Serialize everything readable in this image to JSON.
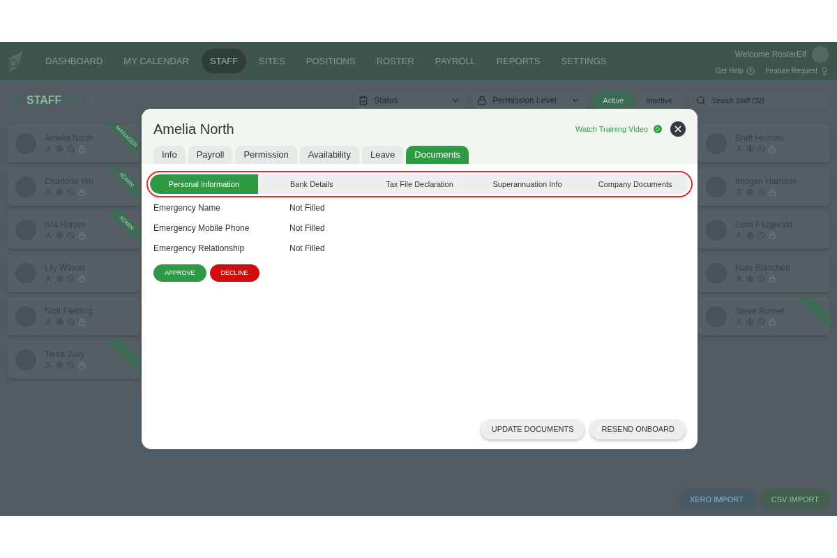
{
  "nav": {
    "items": [
      {
        "label": "DASHBOARD",
        "selected": false
      },
      {
        "label": "MY CALENDAR",
        "selected": false
      },
      {
        "label": "STAFF",
        "selected": true
      },
      {
        "label": "SITES",
        "selected": false
      },
      {
        "label": "POSITIONS",
        "selected": false
      },
      {
        "label": "ROSTER",
        "selected": false
      },
      {
        "label": "PAYROLL",
        "selected": false
      },
      {
        "label": "REPORTS",
        "selected": false
      },
      {
        "label": "SETTINGS",
        "selected": false
      }
    ],
    "welcome": "Welcome RosterElf",
    "get_help": "Get Help",
    "feature_request": "Feature Request"
  },
  "toolbar": {
    "title": "STAFF",
    "status": "Status",
    "permission": "Permission Level",
    "toggle": [
      {
        "label": "Active",
        "selected": true
      },
      {
        "label": "Inactive",
        "selected": false
      }
    ],
    "search_placeholder": "Search Staff (32)"
  },
  "staff_left": [
    {
      "name": "Amelia North",
      "role": "MANAGER"
    },
    {
      "name": "Charlotte Wu",
      "role": "ADMIN"
    },
    {
      "name": "Isla Harper",
      "role": "ADMIN"
    },
    {
      "name": "Lily Wilson"
    },
    {
      "name": "Nick Fielding"
    },
    {
      "name": "Tania Juvy",
      "ribbon": true
    }
  ],
  "staff_right": [
    {
      "name": "Brett Holmes"
    },
    {
      "name": "Imogen Harrison"
    },
    {
      "name": "Liam Fitzgerald"
    },
    {
      "name": "Nate Blanchett"
    },
    {
      "name": "Steve Russel",
      "ribbon": true
    }
  ],
  "import_buttons": [
    {
      "label": "XERO IMPORT",
      "kind": "xero"
    },
    {
      "label": "CSV IMPORT",
      "kind": "csv"
    }
  ],
  "modal": {
    "title": "Amelia North",
    "watch_video": "Watch Training Video",
    "tabs": [
      {
        "label": "Info",
        "selected": false
      },
      {
        "label": "Payroll",
        "selected": false
      },
      {
        "label": "Permission",
        "selected": false
      },
      {
        "label": "Availability",
        "selected": false
      },
      {
        "label": "Leave",
        "selected": false
      },
      {
        "label": "Documents",
        "selected": true
      }
    ],
    "subtabs_highlighted": true,
    "subtabs": [
      {
        "label": "Personal Information",
        "selected": true
      },
      {
        "label": "Bank Details",
        "selected": false
      },
      {
        "label": "Tax File Declaration",
        "selected": false
      },
      {
        "label": "Superannuation Info",
        "selected": false
      },
      {
        "label": "Company Documents",
        "selected": false
      }
    ],
    "fields": [
      {
        "label": "Emergency Name",
        "value": "Not Filled"
      },
      {
        "label": "Emergency Mobile Phone",
        "value": "Not Filled"
      },
      {
        "label": "Emergency Relationship",
        "value": "Not Filled"
      }
    ],
    "approve": "APPROVE",
    "decline": "DECLINE",
    "footer_buttons": [
      "UPDATE DOCUMENTS",
      "RESEND ONBOARD"
    ]
  }
}
